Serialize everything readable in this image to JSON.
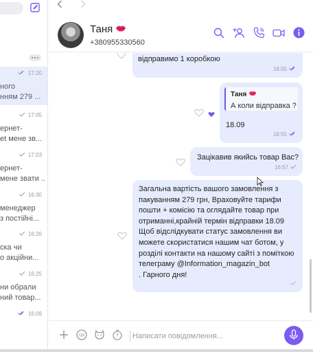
{
  "colors": {
    "accent": "#7a5cf0",
    "bubble": "#e6ecfd",
    "active_item": "#e8edfb",
    "muted": "#9a9aa6"
  },
  "sidebar": {
    "items": [
      {
        "time": "17:20",
        "lines": [
          "ного",
          "нням 279 ..."
        ],
        "active": true
      },
      {
        "time": "17:05",
        "lines": [
          "ернет-",
          "et мене зв..."
        ],
        "active": false
      },
      {
        "time": "17:03",
        "lines": [
          "ернет-",
          "мене звати ..."
        ],
        "active": false
      },
      {
        "time": "16:30",
        "lines": [
          "менеджер",
          "з постійні..."
        ],
        "active": false
      },
      {
        "time": "16:26",
        "lines": [
          "ска чи",
          "о акційни..."
        ],
        "active": false
      },
      {
        "time": "16:25",
        "lines": [
          "ни обрали",
          "ний товар..."
        ],
        "active": false
      },
      {
        "time": "16:09",
        "lines": [],
        "active": false
      }
    ]
  },
  "header": {
    "name": "Таня",
    "name_emoji": "lips-icon",
    "phone": "+380955330560",
    "actions": [
      "search-icon",
      "add-participant-icon",
      "call-icon",
      "video-icon",
      "info-icon"
    ]
  },
  "messages": [
    {
      "text": "відправимо 1 коробкою",
      "time": "16:55",
      "status": "read"
    },
    {
      "reply_to_name": "Таня",
      "reply_to_text": "А коли відправка ?",
      "text": "18.09",
      "time": "16:55",
      "status": "read",
      "reaction": "heart"
    },
    {
      "text": "Зацікавив якийсь товар Вас?",
      "time": "16:57",
      "status": "delivered"
    },
    {
      "lines": [
        "Загальна вартість вашого замовлення з",
        "пакуванням 279 грн, Враховуйте тарифи",
        "пошти + комісію  та оглядайте товар при",
        "отриманні,крайній термін відправки 18.09",
        "Щоб відслідкувати статус замовлення ви",
        "можете скористатися нашим чат ботом, у",
        "розділі контакти на нашому сайті з поміткою",
        "телеграму @Information_magazin_bot",
        ". Гарного дня!"
      ],
      "status": "sent"
    }
  ],
  "composer": {
    "placeholder": "Написати повідомлення..."
  }
}
